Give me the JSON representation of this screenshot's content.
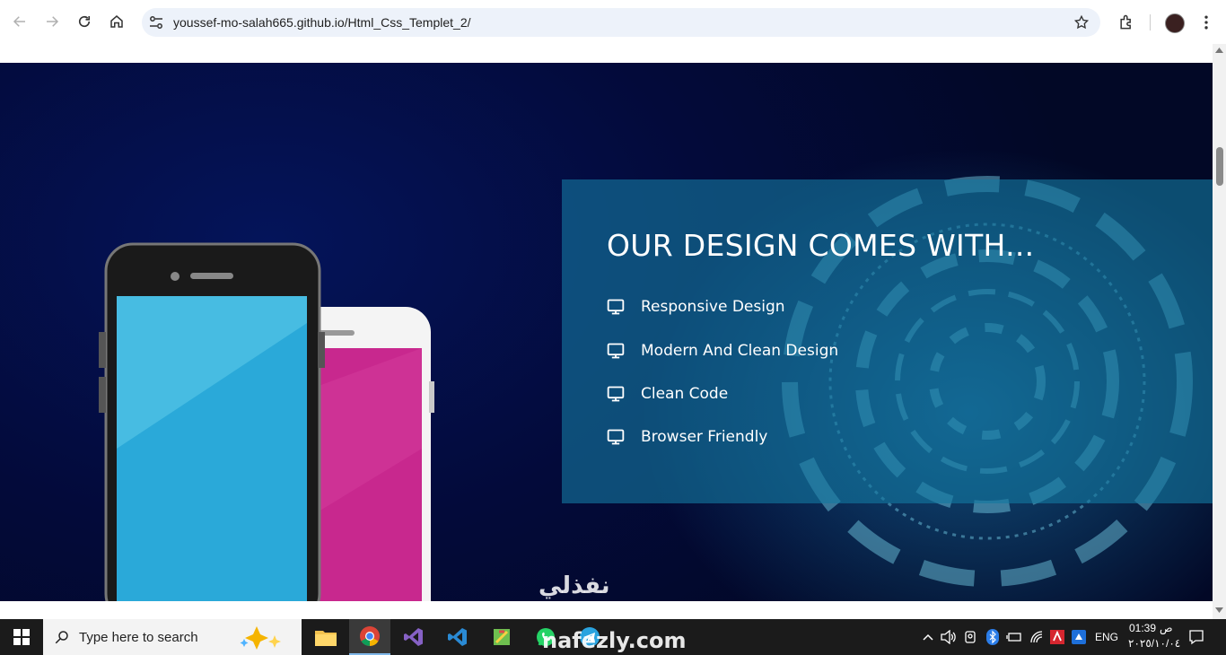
{
  "browser": {
    "url": "youssef-mo-salah665.github.io/Html_Css_Templet_2/"
  },
  "features": {
    "title": "OUR DESIGN COMES WITH...",
    "items": [
      {
        "label": "Responsive Design",
        "icon": "monitor-icon"
      },
      {
        "label": "Modern And Clean Design",
        "icon": "monitor-icon"
      },
      {
        "label": "Clean Code",
        "icon": "monitor-icon"
      },
      {
        "label": "Browser Friendly",
        "icon": "monitor-icon"
      }
    ]
  },
  "watermark": {
    "arabic": "نفذلي",
    "latin": "nafezly.com"
  },
  "taskbar": {
    "search_placeholder": "Type here to search",
    "language": "ENG",
    "am_pm": "ص",
    "time": "01:39",
    "date": "٢٠٢٥/١٠/٠٤"
  },
  "colors": {
    "features_box": "#1478a0",
    "page_bg": "#030a3a",
    "phone_blue": "#2aa9d9",
    "phone_pink": "#c8288e"
  }
}
